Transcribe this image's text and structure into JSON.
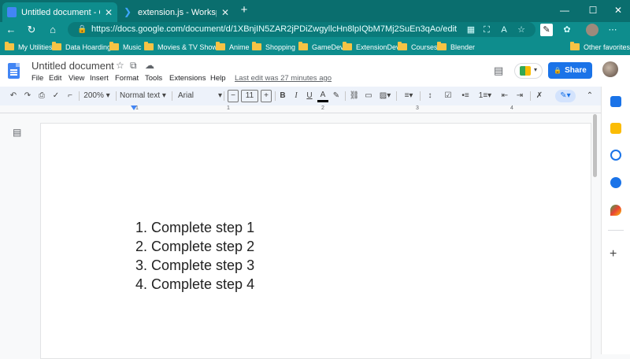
{
  "browser": {
    "tabs": [
      {
        "title": "Untitled document - Google Docs",
        "icon": "docs-icon",
        "active": true
      },
      {
        "title": "extension.js - Workspace - Visual Studio Code",
        "icon": "vscode-icon",
        "active": false
      }
    ],
    "new_tab": "+",
    "window": {
      "minimize": "—",
      "maximize": "☐",
      "close": "✕"
    },
    "url": "https://docs.google.com/document/d/1XBnjIN5ZAR2jPDiZwgyllcHn8lpIQbM7Mj2SuEn3qAo/edit",
    "bookmarks": [
      "My Utilities",
      "Data Hoarding",
      "Music",
      "Movies & TV Shows",
      "Anime",
      "Shopping",
      "GameDev",
      "ExtensionDev",
      "Courses",
      "Blender"
    ],
    "other_favorites": "Other favorites"
  },
  "docs": {
    "title": "Untitled document",
    "menu": [
      "File",
      "Edit",
      "View",
      "Insert",
      "Format",
      "Tools",
      "Extensions",
      "Help"
    ],
    "last_edit": "Last edit was 27 minutes ago",
    "share_label": "Share",
    "toolbar": {
      "zoom": "200%",
      "style": "Normal text",
      "font": "Arial",
      "font_size": "11",
      "minus": "−",
      "plus": "+"
    },
    "ruler_numbers": [
      "1",
      "1",
      "2",
      "3",
      "4"
    ],
    "list_items": [
      "1. Complete step 1",
      "2. Complete step 2",
      "3. Complete step 3",
      "4. Complete step 4"
    ],
    "colors": {
      "accent": "#1a73e8",
      "browser": "#0e8d8d",
      "toolbar": "#edf2fa"
    }
  }
}
